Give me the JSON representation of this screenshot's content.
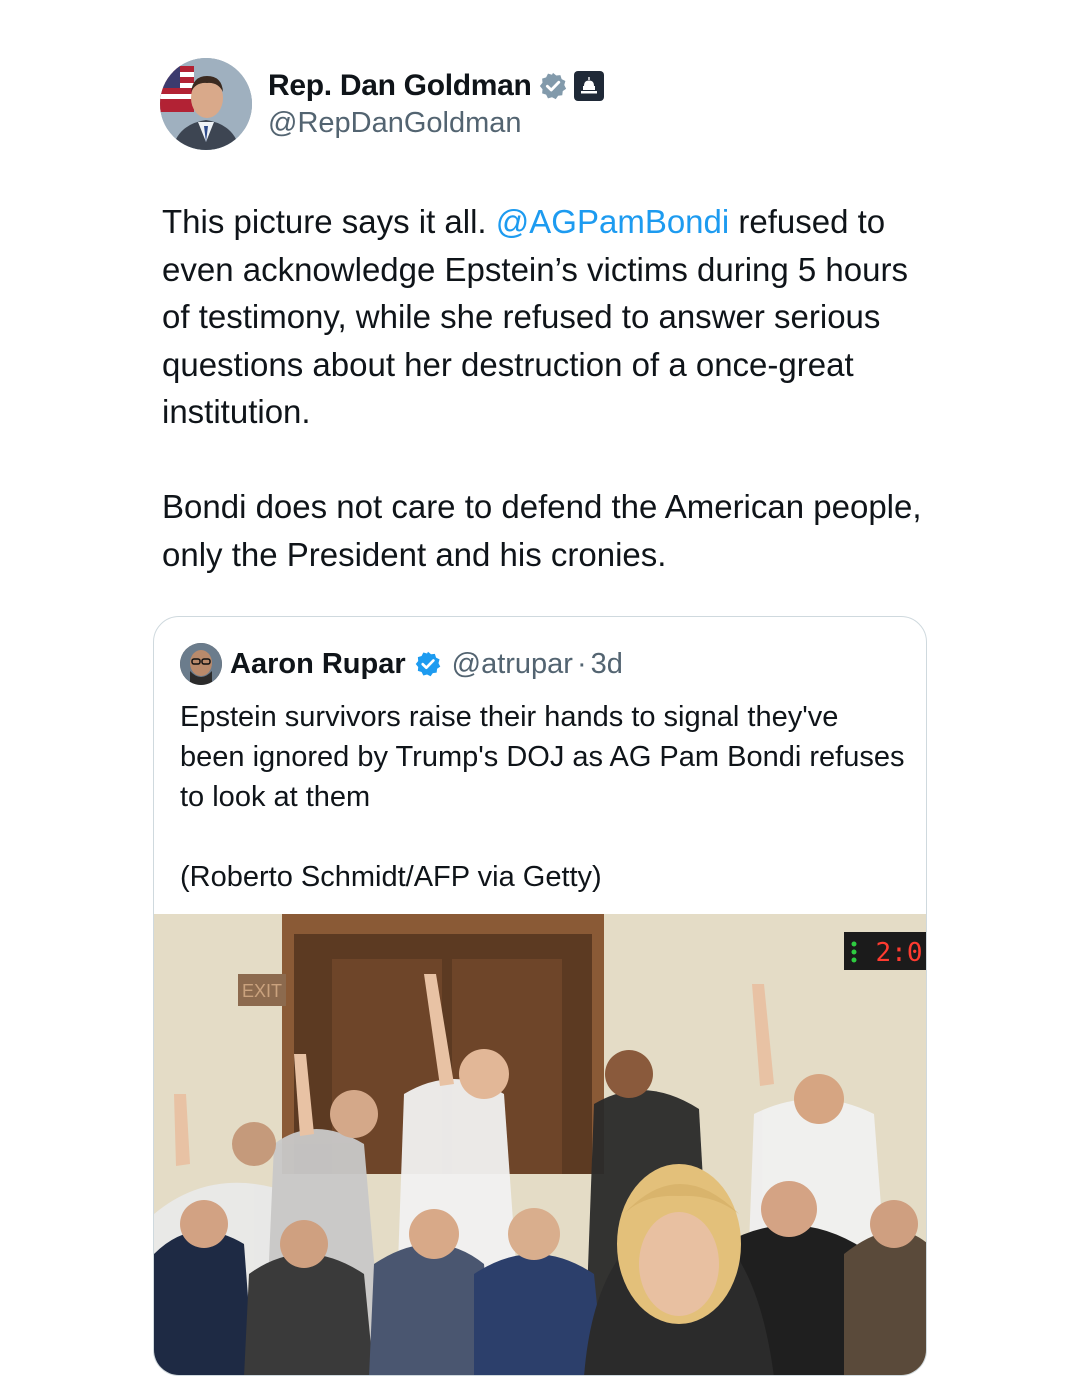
{
  "author": {
    "display_name": "Rep. Dan Goldman",
    "handle": "@RepDanGoldman"
  },
  "tweet": {
    "part1_before": "This picture says it all. ",
    "mention": "@AGPamBondi",
    "part1_after": " refused to even acknowledge Epstein’s victims during 5 hours of testimony, while she refused to answer serious questions about her destruction of a once-great institution.",
    "part2": "Bondi does not care to defend the American people, only the President and his cronies."
  },
  "quote": {
    "display_name": "Aaron Rupar",
    "handle": "@atrupar",
    "separator": "·",
    "time": "3d",
    "text": "Epstein survivors raise their hands to signal they've been ignored by Trump's DOJ as AG Pam Bondi refuses to look at them",
    "credit": "(Roberto Schmidt/AFP via Getty)"
  },
  "photo": {
    "exit_sign": "EXIT",
    "timer": "2:0"
  },
  "colors": {
    "link": "#1d9bf0",
    "verified": "#1d9bf0",
    "secondary_text": "#536471",
    "border": "#cfd9de"
  },
  "icons": [
    "verified-badge-icon",
    "government-badge-icon",
    "capitol-icon"
  ]
}
